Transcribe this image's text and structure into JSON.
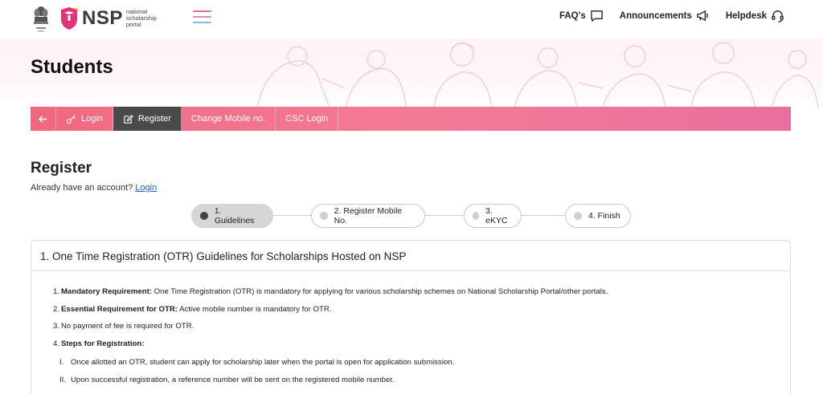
{
  "header": {
    "logo_text": "NSP",
    "logo_sub": "national scholarship portal",
    "links": [
      {
        "label": "FAQ's",
        "icon": "chat-icon"
      },
      {
        "label": "Announcements",
        "icon": "megaphone-icon"
      },
      {
        "label": "Helpdesk",
        "icon": "headset-icon"
      }
    ]
  },
  "page_title": "Students",
  "nav": {
    "back_icon": "arrow-left-icon",
    "items": [
      {
        "label": "Login",
        "icon": "key-icon"
      },
      {
        "label": "Register",
        "icon": "edit-icon"
      },
      {
        "label": "Change Mobile no."
      },
      {
        "label": "CSC Login"
      }
    ],
    "active": "Register"
  },
  "register": {
    "title": "Register",
    "already_text": "Already have an account?",
    "login_link": "Login"
  },
  "stepper": {
    "steps": [
      "1. Guidelines",
      "2. Register Mobile No.",
      "3. eKYC",
      "4. Finish"
    ],
    "active_index": 0
  },
  "guidelines": {
    "heading": "1. One Time Registration (OTR) Guidelines for Scholarships Hosted on NSP",
    "items": [
      {
        "num": "1.",
        "bold": "Mandatory Requirement:",
        "text": " One Time Registration (OTR) is mandatory for applying for various scholarship schemes on National Scholarship Portal/other portals."
      },
      {
        "num": "2.",
        "bold": "Essential Requirement for OTR:",
        "text": " Active mobile number is mandatory for OTR."
      },
      {
        "num": "3.",
        "bold": "",
        "text": "No payment of fee is required for OTR."
      },
      {
        "num": "4.",
        "bold": "Steps for Registration:",
        "text": ""
      }
    ],
    "sub_items": [
      {
        "num": "I.",
        "text": "Once allotted an OTR, student can apply for scholarship later when the portal is open for application submission."
      },
      {
        "num": "II.",
        "text": "Upon successful registration, a reference number will be sent on the registered mobile number."
      }
    ]
  },
  "colors": {
    "nav_gradient_start": "#f0687f",
    "nav_gradient_end": "#ea6fa0",
    "nav_active": "#4a4a4a",
    "link": "#1a5fd6",
    "step_active": "#d6d6d6"
  }
}
